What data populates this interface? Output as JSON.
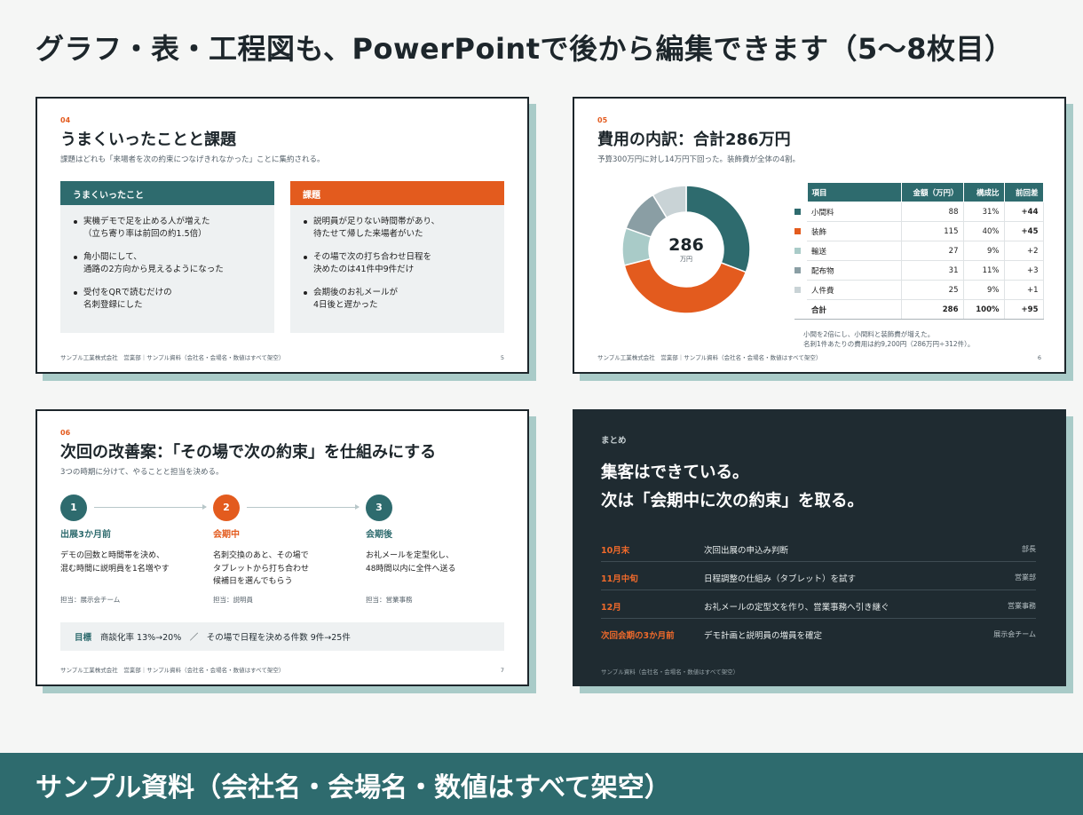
{
  "headline": "グラフ・表・工程図も、PowerPointで後から編集できます（5〜8枚目）",
  "footer_common": "サンプル工業株式会社　営業部｜サンプル資料（会社名・会場名・数値はすべて架空）",
  "slide5": {
    "num": "04",
    "title": "うまくいったことと課題",
    "subtitle": "課題はどれも「来場者を次の約束につなげきれなかった」ことに集約される。",
    "left": {
      "head": "うまくいったこと",
      "items": [
        "実機デモで足を止める人が増えた\n（立ち寄り率は前回の約1.5倍）",
        "角小間にして、\n通路の2方向から見えるようになった",
        "受付をQRで読むだけの\n名刺登録にした"
      ]
    },
    "right": {
      "head": "課題",
      "items": [
        "説明員が足りない時間帯があり、\n待たせて帰した来場者がいた",
        "その場で次の打ち合わせ日程を\n決めたのは41件中9件だけ",
        "会期後のお礼メールが\n4日後と遅かった"
      ]
    },
    "page": "5"
  },
  "slide6": {
    "num": "05",
    "title": "費用の内訳：合計286万円",
    "subtitle": "予算300万円に対し14万円下回った。装飾費が全体の4割。",
    "center_value": "286",
    "center_unit": "万円",
    "headers": [
      "項目",
      "金額（万円）",
      "構成比",
      "前回差"
    ],
    "rows": [
      {
        "name": "小間料",
        "amount": "88",
        "ratio": "31%",
        "diff": "+44"
      },
      {
        "name": "装飾",
        "amount": "115",
        "ratio": "40%",
        "diff": "+45"
      },
      {
        "name": "輸送",
        "amount": "27",
        "ratio": "9%",
        "diff": "+2"
      },
      {
        "name": "配布物",
        "amount": "31",
        "ratio": "11%",
        "diff": "+3"
      },
      {
        "name": "人件費",
        "amount": "25",
        "ratio": "9%",
        "diff": "+1"
      }
    ],
    "total": {
      "name": "合計",
      "amount": "286",
      "ratio": "100%",
      "diff": "+95"
    },
    "note1": "小間を2倍にし、小間料と装飾費が増えた。",
    "note2": "名刺1件あたりの費用は約9,200円（286万円÷312件）。",
    "page": "6"
  },
  "chart_data": {
    "type": "pie",
    "categories": [
      "小間料",
      "装飾",
      "輸送",
      "配布物",
      "人件費"
    ],
    "values": [
      88,
      115,
      27,
      31,
      25
    ],
    "colors": [
      "#2e6b6e",
      "#e35b1e",
      "#a9cbc8",
      "#8a9ea4",
      "#c9d3d6"
    ]
  },
  "slide7": {
    "num": "06",
    "title": "次回の改善案：「その場で次の約束」を仕組みにする",
    "subtitle": "3つの時期に分けて、やることと担当を決める。",
    "steps": [
      {
        "n": "1",
        "phase": "出展3か月前",
        "desc": "デモの回数と時間帯を決め、\n混む時間に説明員を1名増やす",
        "owner": "担当：展示会チーム"
      },
      {
        "n": "2",
        "phase": "会期中",
        "desc": "名刺交換のあと、その場で\nタブレットから打ち合わせ\n候補日を選んでもらう",
        "owner": "担当：説明員"
      },
      {
        "n": "3",
        "phase": "会期後",
        "desc": "お礼メールを定型化し、\n48時間以内に全件へ送る",
        "owner": "担当：営業事務"
      }
    ],
    "goal_label": "目標",
    "goal_text": "商談化率 13%→20%　／　その場で日程を決める件数 9件→25件",
    "page": "7"
  },
  "slide8": {
    "label": "まとめ",
    "title1": "集客はできている。",
    "title2": "次は「会期中に次の約束」を取る。",
    "rows": [
      {
        "when": "10月末",
        "what": "次回出展の申込み判断",
        "who": "部長"
      },
      {
        "when": "11月中旬",
        "what": "日程調整の仕組み（タブレット）を試す",
        "who": "営業部"
      },
      {
        "when": "12月",
        "what": "お礼メールの定型文を作り、営業事務へ引き継ぐ",
        "who": "営業事務"
      },
      {
        "when": "次回会期の3か月前",
        "what": "デモ計画と説明員の増員を確定",
        "who": "展示会チーム"
      }
    ],
    "footer": "サンプル資料（会社名・会場名・数値はすべて架空）"
  },
  "banner": "サンプル資料（会社名・会場名・数値はすべて架空）"
}
